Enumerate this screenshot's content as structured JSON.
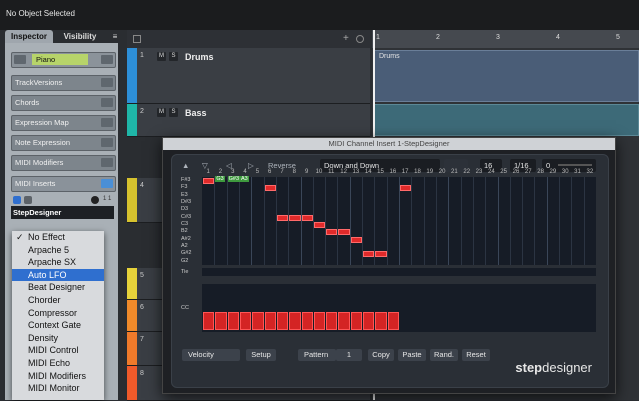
{
  "status_bar": {
    "text": "No Object Selected"
  },
  "inspector": {
    "tabs": [
      "Inspector",
      "Visibility",
      "≡"
    ],
    "instrument": "Piano",
    "sections": [
      "TrackVersions",
      "Chords",
      "Expression Map",
      "Note Expression",
      "MIDI Modifiers",
      "MIDI Inserts"
    ],
    "slot_value": "StepDesigner",
    "slot_count": "1 1"
  },
  "dropdown": {
    "checkmark": "✓",
    "items": [
      "No Effect",
      "Arpache 5",
      "Arpache SX",
      "Auto LFO",
      "Beat Designer",
      "Chorder",
      "Compressor",
      "Context Gate",
      "Density",
      "MIDI Control",
      "MIDI Echo",
      "MIDI Modifiers",
      "MIDI Monitor"
    ],
    "selected_index": 3
  },
  "tracks": [
    {
      "number": "1",
      "name": "Drums",
      "color": "#2d8fd8",
      "buttons": [
        "M",
        "S"
      ]
    },
    {
      "number": "2",
      "name": "Bass",
      "color": "#1fb6a8",
      "buttons": [
        "M",
        "S"
      ]
    },
    {
      "number": "4",
      "color": "#d6c22e"
    },
    {
      "number": "5",
      "color": "#e6d23a"
    },
    {
      "number": "6",
      "color": "#f08a2a"
    },
    {
      "number": "7",
      "color": "#f07a2a"
    },
    {
      "number": "8",
      "color": "#f05a2a"
    }
  ],
  "arrange": {
    "ruler": [
      "1",
      "2",
      "3",
      "4",
      "5"
    ],
    "part_name": "Drums"
  },
  "plugin": {
    "title": "MIDI Channel Insert 1-StepDesigner",
    "toolbar": {
      "arrow_up": "▲",
      "arrow_down": "▽",
      "arrow_left": "◁",
      "arrow_right": "▷",
      "reverse": "Reverse",
      "pattern_name": "Down and Down",
      "steps": "16",
      "resolution": "1/16",
      "swing": "0"
    },
    "columns": [
      "1",
      "2",
      "3",
      "4",
      "5",
      "6",
      "7",
      "8",
      "9",
      "10",
      "11",
      "12",
      "13",
      "14",
      "15",
      "16",
      "17",
      "18",
      "19",
      "20",
      "21",
      "22",
      "23",
      "24",
      "25",
      "26",
      "27",
      "28",
      "29",
      "30",
      "31",
      "32"
    ],
    "pitch_labels": [
      "F#3",
      "F3",
      "E3",
      "D#3",
      "D3",
      "C#3",
      "C3",
      "B2",
      "A#2",
      "A2",
      "G#2",
      "G2"
    ],
    "note_labels": [
      "G3",
      "G#3",
      "A3"
    ],
    "tie_label": "Tie",
    "cc_label": "CC",
    "cc_values": [
      0.75,
      0.75,
      0.75,
      0.75,
      0.75,
      0.75,
      0.75,
      0.75,
      0.75,
      0.75,
      0.75,
      0.75,
      0.75,
      0.75,
      0.75,
      0.75
    ],
    "bottom": {
      "velocity": "Velocity",
      "setup": "Setup",
      "pattern_label": "Pattern",
      "pattern_number": "1",
      "copy": "Copy",
      "paste": "Paste",
      "random": "Rand.",
      "reset": "Reset"
    },
    "logo_bold": "step",
    "logo_rest": "designer"
  }
}
